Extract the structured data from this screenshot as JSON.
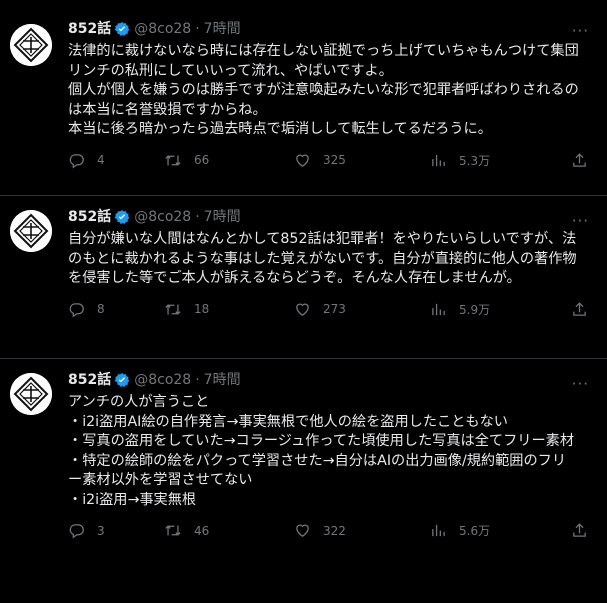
{
  "tweets": [
    {
      "name": "852話",
      "handle": "@8co28",
      "sep": "·",
      "time": "7時間",
      "body": "法律的に裁けないなら時には存在しない証拠でっち上げていちゃもんつけて集団リンチの私刑にしていいって流れ、やばいですよ。\n個人が個人を嫌うのは勝手ですが注意喚起みたいな形で犯罪者呼ばわりされるのは本当に名誉毀損ですからね。\n本当に後ろ暗かったら過去時点で垢消しして転生してるだろうに。",
      "replies": "4",
      "retweets": "66",
      "likes": "325",
      "views": "5.3万"
    },
    {
      "name": "852話",
      "handle": "@8co28",
      "sep": "·",
      "time": "7時間",
      "body": "自分が嫌いな人間はなんとかして852話は犯罪者！をやりたいらしいですが、法のもとに裁かれるような事はした覚えがないです。自分が直接的に他人の著作物を侵害した等でご本人が訴えるならどうぞ。そんな人存在しませんが。",
      "replies": "8",
      "retweets": "18",
      "likes": "273",
      "views": "5.9万"
    },
    {
      "name": "852話",
      "handle": "@8co28",
      "sep": "·",
      "time": "7時間",
      "body": "アンチの人が言うこと\n・i2i盗用AI絵の自作発言→事実無根で他人の絵を盗用したこともない\n・写真の盗用をしていた→コラージュ作ってた頃使用した写真は全てフリー素材\n・特定の絵師の絵をパクって学習させた→自分はAIの出力画像/規約範囲のフリー素材以外を学習させてない\n・i2i盗用→事実無根",
      "replies": "3",
      "retweets": "46",
      "likes": "322",
      "views": "5.6万"
    }
  ],
  "more_label": "···",
  "colors": {
    "background": "#000000",
    "text": "#e7e9ea",
    "muted": "#71767b",
    "verified": "#1d9bf0",
    "divider": "#2f3336"
  },
  "icons": [
    "avatar-logo",
    "verified-badge-icon",
    "reply-icon",
    "retweet-icon",
    "like-icon",
    "views-icon",
    "share-icon",
    "more-icon"
  ]
}
